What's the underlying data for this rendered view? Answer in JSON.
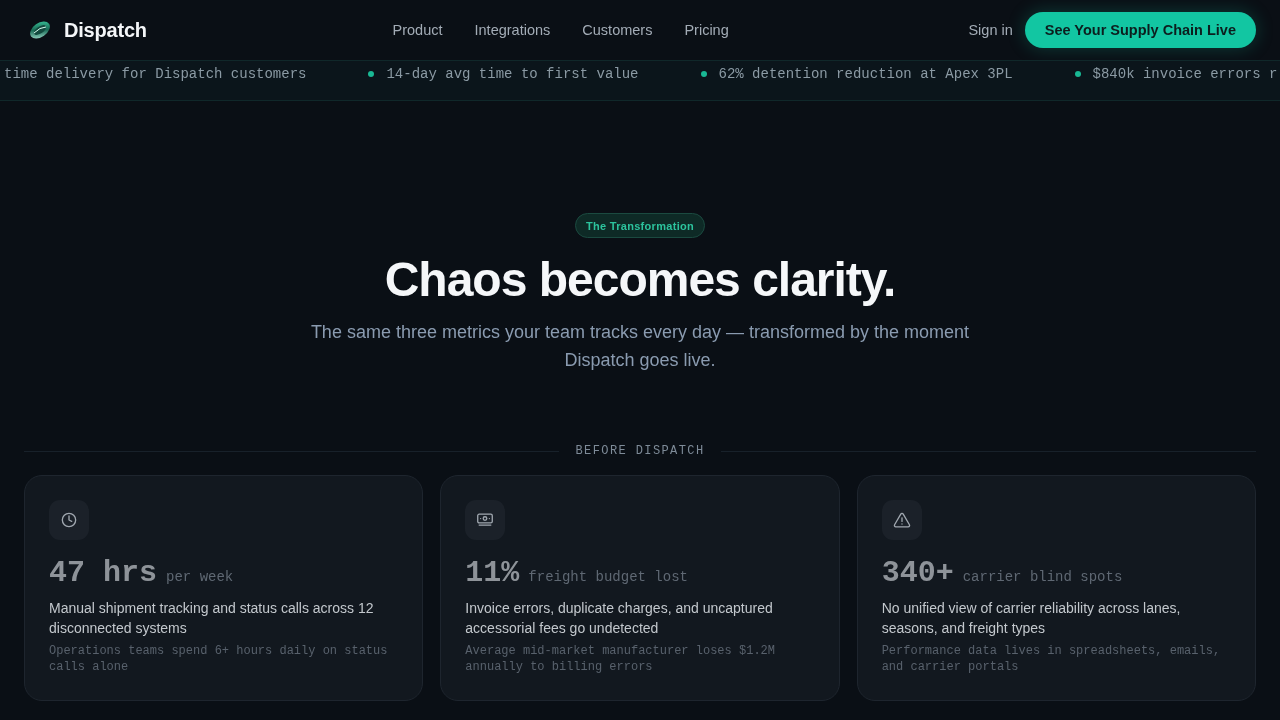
{
  "nav": {
    "brand": "Dispatch",
    "links": [
      "Product",
      "Integrations",
      "Customers",
      "Pricing"
    ],
    "sign_in": "Sign in",
    "cta": "See Your Supply Chain Live"
  },
  "ticker": [
    "time delivery for Dispatch customers",
    "14-day avg time to first value",
    "62% detention reduction at Apex 3PL",
    "$840k invoice errors r"
  ],
  "hero": {
    "badge": "The Transformation",
    "title": "Chaos becomes clarity.",
    "subtitle": "The same three metrics your team tracks every day — transformed by the moment Dispatch goes live."
  },
  "before_section": {
    "label": "BEFORE DISPATCH",
    "cards": [
      {
        "value": "47 hrs",
        "unit": "per week",
        "description": "Manual shipment tracking and status calls across 12 disconnected systems",
        "note": "Operations teams spend 6+ hours daily on status calls alone"
      },
      {
        "value": "11%",
        "unit": "freight budget lost",
        "description": "Invoice errors, duplicate charges, and uncaptured accessorial fees go undetected",
        "note": "Average mid-market manufacturer loses $1.2M annually to billing errors"
      },
      {
        "value": "340+",
        "unit": "carrier blind spots",
        "description": "No unified view of carrier reliability across lanes, seasons, and freight types",
        "note": "Performance data lives in spreadsheets, emails, and carrier portals"
      }
    ]
  }
}
